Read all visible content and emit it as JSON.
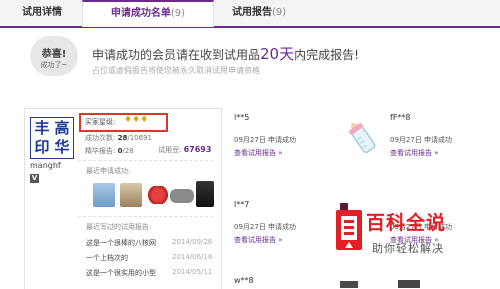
{
  "tabs": [
    {
      "label": "试用详情",
      "count": ""
    },
    {
      "label": "申请成功名单",
      "count": "(9)"
    },
    {
      "label": "试用报告",
      "count": "(9)"
    }
  ],
  "banner": {
    "bubble_line1": "恭喜!",
    "bubble_line2": "成功了~",
    "main_before": "申请成功的会员请在收到试用品",
    "days": "20天",
    "main_after": "内完成报告!",
    "sub": "占位或虚假报告将使您被永久取消试用申请资格"
  },
  "user": {
    "avatar_chars": [
      "丰",
      "高",
      "印",
      "华"
    ],
    "name": "manghf",
    "badge": "V",
    "stars_label": "买家星级:",
    "stars": "♦♦♦",
    "stat1_label": "成功次数:",
    "stat1_value": "28",
    "stat1_total": "/10691",
    "stat2_label": "精华报告:",
    "stat2_value": "0",
    "stat2_total": "/28",
    "stat3_label": "试用豆:",
    "stat3_value": "67693",
    "recent_label": "最近申请成功:",
    "recent_reports_label": "最近写过的试用报告:",
    "reports": [
      {
        "title": "这是一个很棒的八核网",
        "date": "2014/09/26"
      },
      {
        "title": "一个上档次的",
        "date": "2014/06/18"
      },
      {
        "title": "这是一个很实用的小型",
        "date": "2014/05/11"
      }
    ]
  },
  "applicants": [
    {
      "name": "l**5",
      "date": "09月27日 申请成功",
      "link": "查看试用报告 »"
    },
    {
      "name": "fF**8",
      "date": "09月27日 申请成功",
      "link": "查看试用报告 »"
    },
    {
      "name": "l**7",
      "date": "09月27日 申请成功",
      "link": "查看试用报告 »"
    },
    {
      "name": "",
      "date": "09月27日 申请成功",
      "link": "查看试用报告 »"
    },
    {
      "name": "w**8",
      "date": "",
      "link": ""
    }
  ],
  "watermark": {
    "title": "百科全说",
    "sub": "助你轻松解决"
  },
  "colors": {
    "accent": "#6b2a8f",
    "highlight": "#d83a2a",
    "star": "#e6a100"
  }
}
